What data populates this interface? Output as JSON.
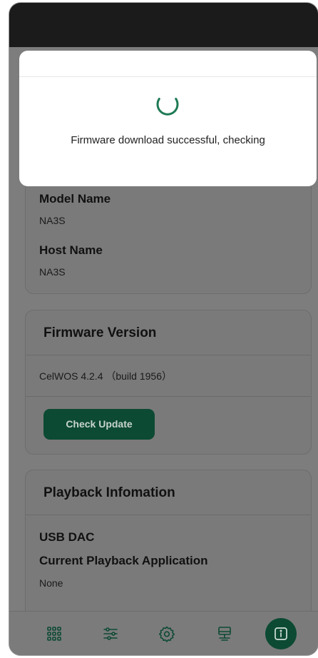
{
  "device_info": {
    "model_name_label": "Model Name",
    "model_name_value": "NA3S",
    "host_name_label": "Host Name",
    "host_name_value": "NA3S"
  },
  "firmware": {
    "title": "Firmware Version",
    "version": "CelWOS 4.2.4 （build 1956）",
    "check_update_label": "Check Update"
  },
  "playback": {
    "title": "Playback Infomation",
    "usb_dac_label": "USB DAC",
    "current_app_label": "Current Playback Application",
    "current_app_value": "None"
  },
  "dialog": {
    "message": "Firmware download successful, checking"
  },
  "bottom_nav": {
    "items": [
      {
        "icon": "grid-icon",
        "active": false
      },
      {
        "icon": "sliders-icon",
        "active": false
      },
      {
        "icon": "gear-icon",
        "active": false
      },
      {
        "icon": "network-icon",
        "active": false
      },
      {
        "icon": "info-icon",
        "active": true
      }
    ]
  },
  "colors": {
    "accent": "#0c4a33",
    "spinner": "#1f7a55",
    "overlay": "#7d7d7d",
    "dialog_bg": "#ffffff"
  }
}
